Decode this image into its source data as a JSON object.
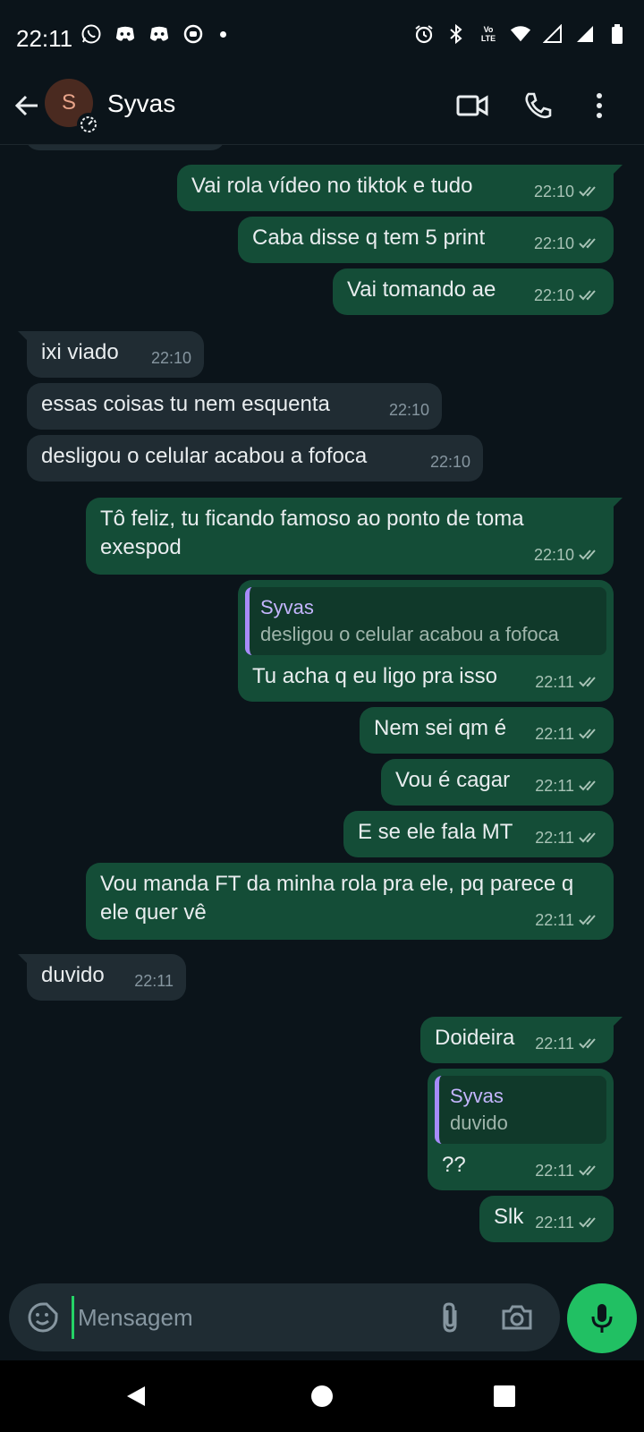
{
  "status_bar": {
    "time": "22:11",
    "left_icons": [
      "whatsapp-icon",
      "discord-icon",
      "discord-icon",
      "game-icon"
    ],
    "right_icons": [
      "alarm-icon",
      "bluetooth-icon",
      "volte-icon",
      "wifi-icon",
      "signal-icon",
      "signal-icon",
      "battery-icon"
    ],
    "volte_label_top": "Vo",
    "volte_label_bottom": "LTE"
  },
  "header": {
    "avatar_initial": "S",
    "contact_name": "Syvas",
    "actions": [
      "video-call-icon",
      "voice-call-icon",
      "more-options-icon"
    ]
  },
  "messages": [
    {
      "direction": "out",
      "text": "Vai rola vídeo no tiktok e tudo",
      "time": "22:10",
      "status": "read",
      "tail": true
    },
    {
      "direction": "out",
      "text": "Caba disse q tem 5 print",
      "time": "22:10",
      "status": "read"
    },
    {
      "direction": "out",
      "text": "Vai tomando ae",
      "time": "22:10",
      "status": "read"
    },
    {
      "direction": "in",
      "text": "ixi viado",
      "time": "22:10",
      "tail": true
    },
    {
      "direction": "in",
      "text": "essas coisas tu nem esquenta",
      "time": "22:10"
    },
    {
      "direction": "in",
      "text": "desligou o celular acabou a fofoca",
      "time": "22:10"
    },
    {
      "direction": "out",
      "text": "Tô feliz, tu ficando famoso ao ponto de toma exespod",
      "time": "22:10",
      "status": "read",
      "tail": true
    },
    {
      "direction": "out",
      "quote_name": "Syvas",
      "quote_text": "desligou o celular acabou a fofoca",
      "text": "Tu acha q eu ligo pra isso",
      "time": "22:11",
      "status": "read"
    },
    {
      "direction": "out",
      "text": "Nem sei qm é",
      "time": "22:11",
      "status": "read"
    },
    {
      "direction": "out",
      "text": "Vou é cagar",
      "time": "22:11",
      "status": "read"
    },
    {
      "direction": "out",
      "text": "E se ele fala MT",
      "time": "22:11",
      "status": "read"
    },
    {
      "direction": "out",
      "text": "Vou manda FT da minha rola pra ele, pq parece q ele quer vê",
      "time": "22:11",
      "status": "read"
    },
    {
      "direction": "in",
      "text": "duvido",
      "time": "22:11",
      "tail": true
    },
    {
      "direction": "out",
      "text": "Doideira",
      "time": "22:11",
      "status": "read",
      "tail": true
    },
    {
      "direction": "out",
      "quote_name": "Syvas",
      "quote_text": "duvido",
      "text": "??",
      "time": "22:11",
      "status": "read"
    },
    {
      "direction": "out",
      "text": "Slk",
      "time": "22:11",
      "status": "read"
    }
  ],
  "input_bar": {
    "placeholder": "Mensagem",
    "icons": [
      "emoji-icon",
      "attach-icon",
      "camera-icon",
      "microphone-icon"
    ]
  },
  "nav_bar": {
    "buttons": [
      "back-triangle-icon",
      "home-circle-icon",
      "recents-square-icon"
    ]
  },
  "colors": {
    "background": "#0b141a",
    "outgoing_bubble": "#144d37",
    "incoming_bubble": "#202c33",
    "accent": "#21c063",
    "quote_bar": "#a78bfa"
  }
}
